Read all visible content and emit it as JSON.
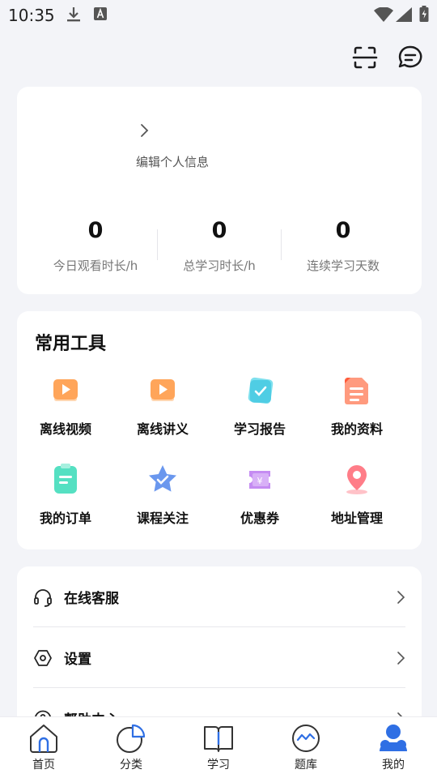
{
  "status_bar": {
    "time": "10:35"
  },
  "profile": {
    "edit_label": "编辑个人信息",
    "stats": [
      {
        "value": "0",
        "label": "今日观看时长/h"
      },
      {
        "value": "0",
        "label": "总学习时长/h"
      },
      {
        "value": "0",
        "label": "连续学习天数"
      }
    ]
  },
  "tools": {
    "title": "常用工具",
    "items": [
      {
        "label": "离线视频",
        "icon": "offline-video-icon"
      },
      {
        "label": "离线讲义",
        "icon": "offline-handout-icon"
      },
      {
        "label": "学习报告",
        "icon": "study-report-icon"
      },
      {
        "label": "我的资料",
        "icon": "my-materials-icon"
      },
      {
        "label": "我的订单",
        "icon": "my-orders-icon"
      },
      {
        "label": "课程关注",
        "icon": "course-follow-icon"
      },
      {
        "label": "优惠券",
        "icon": "coupon-icon"
      },
      {
        "label": "地址管理",
        "icon": "address-icon"
      }
    ]
  },
  "menu": {
    "items": [
      {
        "label": "在线客服",
        "icon": "headset-icon"
      },
      {
        "label": "设置",
        "icon": "settings-icon"
      },
      {
        "label": "帮助中心",
        "icon": "help-icon"
      }
    ]
  },
  "tab_bar": {
    "active": "我的",
    "items": [
      {
        "label": "首页",
        "icon": "home-icon"
      },
      {
        "label": "分类",
        "icon": "category-icon"
      },
      {
        "label": "学习",
        "icon": "study-icon"
      },
      {
        "label": "题库",
        "icon": "question-bank-icon"
      },
      {
        "label": "我的",
        "icon": "profile-icon"
      }
    ]
  },
  "colors": {
    "accent": "#2f6fe4",
    "background": "#f3f4f8",
    "card": "#ffffff"
  }
}
